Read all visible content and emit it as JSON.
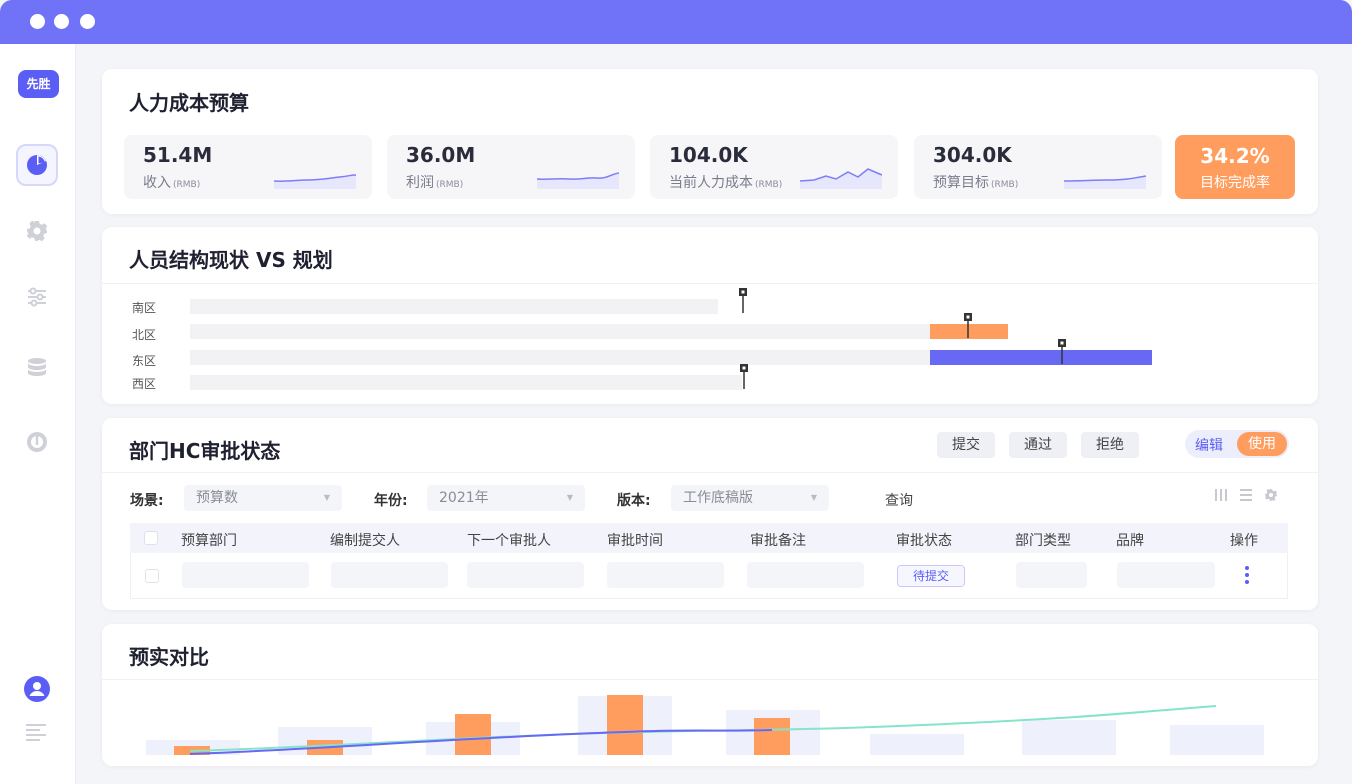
{
  "sidebar": {
    "logo_text": "先胜"
  },
  "budget": {
    "title": "人力成本预算",
    "kpis": [
      {
        "value": "51.4M",
        "label": "收入",
        "unit": "(RMB)"
      },
      {
        "value": "36.0M",
        "label": "利润",
        "unit": "(RMB)"
      },
      {
        "value": "104.0K",
        "label": "当前人力成本",
        "unit": "(RMB)"
      },
      {
        "value": "304.0K",
        "label": "预算目标",
        "unit": "(RMB)"
      }
    ],
    "completion": {
      "value": "34.2%",
      "label": "目标完成率"
    }
  },
  "structure": {
    "title": "人员结构现状 VS 规划",
    "rows": [
      {
        "label": "南区",
        "current": 0.45,
        "planned": 0.47,
        "plan_color": ""
      },
      {
        "label": "北区",
        "current": 0.63,
        "planned": 0.7,
        "plan_color": "#fe9d5e"
      },
      {
        "label": "东区",
        "current": 0.63,
        "planned": 0.82,
        "plan_color": "#6769f5"
      },
      {
        "label": "西区",
        "current": 0.47,
        "planned": 0.47,
        "plan_color": ""
      }
    ]
  },
  "approval": {
    "title": "部门HC审批状态",
    "buttons": {
      "submit": "提交",
      "approve": "通过",
      "reject": "拒绝"
    },
    "toggle": {
      "edit": "编辑",
      "use": "使用"
    },
    "filters": {
      "scene_label": "场景:",
      "scene_value": "预算数",
      "year_label": "年份:",
      "year_value": "2021年",
      "version_label": "版本:",
      "version_value": "工作底稿版",
      "query": "查询"
    },
    "columns": [
      "预算部门",
      "编制提交人",
      "下一个审批人",
      "审批时间",
      "审批备注",
      "审批状态",
      "部门类型",
      "品牌",
      "操作"
    ],
    "row_status": "待提交"
  },
  "comparison": {
    "title": "预实对比"
  },
  "colors": {
    "accent": "#5b5ef5",
    "orange": "#fe9d5e",
    "titlebar": "#7073f7"
  }
}
